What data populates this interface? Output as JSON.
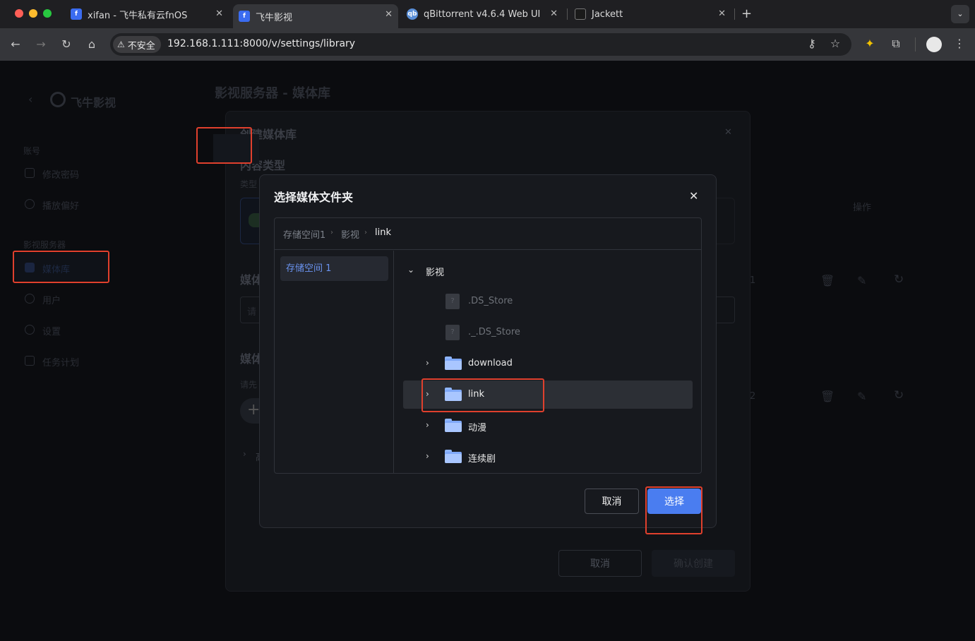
{
  "browser": {
    "tabs": [
      {
        "title": "xifan - 飞牛私有云fnOS",
        "icon": "fnos-icon"
      },
      {
        "title": "飞牛影视",
        "icon": "fnos-icon"
      },
      {
        "title": "qBittorrent v4.6.4 Web UI",
        "icon": "qbittorrent-icon",
        "icon_text": "qb"
      },
      {
        "title": "Jackett",
        "icon": "jackett-icon"
      }
    ],
    "security_label": "不安全",
    "url": "192.168.1.111:8000/v/settings/library"
  },
  "app": {
    "logo": "飞牛影视",
    "page_title": "影视服务器 - 媒体库",
    "sidebar": {
      "sections": [
        {
          "heading": "账号",
          "items": [
            "修改密码",
            "播放偏好"
          ]
        },
        {
          "heading": "影视服务器",
          "items": [
            "媒体库",
            "用户",
            "设置",
            "任务计划"
          ]
        }
      ]
    },
    "bg_column_header": "操作",
    "bg_row_numbers": [
      "1",
      "2"
    ]
  },
  "create_dialog": {
    "title": "创建媒体库",
    "section_content_type": "内容类型",
    "type_hint": "类型",
    "media_label_1": "媒体",
    "media_input_placeholder": "请",
    "media_label_2": "媒体",
    "hint": "请先",
    "advanced_char": "高",
    "cancel": "取消",
    "confirm": "确认创建"
  },
  "folder_picker": {
    "title": "选择媒体文件夹",
    "breadcrumb": [
      "存储空间1",
      "影视",
      "link"
    ],
    "volume": "存储空间 1",
    "tree": {
      "root": "影视",
      "files": [
        ".DS_Store",
        "._.DS_Store"
      ],
      "folders": [
        "download",
        "link",
        "动漫",
        "连续剧"
      ],
      "selected": "link"
    },
    "cancel": "取消",
    "select": "选择"
  },
  "colors": {
    "accent": "#4a7df0",
    "annotation": "#e0402d"
  }
}
